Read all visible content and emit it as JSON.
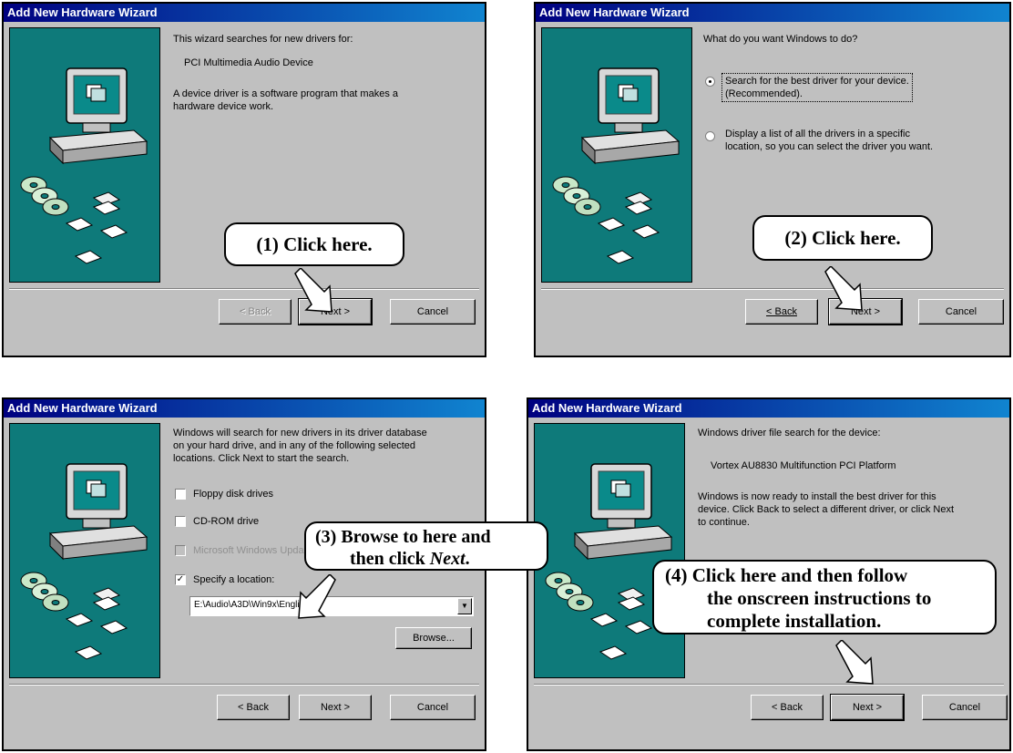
{
  "dialogs": [
    {
      "title": "Add New Hardware Wizard",
      "line1": "This wizard searches for new drivers for:",
      "device": "PCI Multimedia Audio Device",
      "desc1": "A device driver is a software program that makes a",
      "desc2": "hardware device work.",
      "buttons": {
        "back": "< Back",
        "next": "Next >",
        "cancel": "Cancel"
      },
      "callout": "(1)  Click here."
    },
    {
      "title": "Add New Hardware Wizard",
      "question": "What do you want Windows to do?",
      "option1_line1": "Search for the best driver for your device.",
      "option1_line2": "(Recommended).",
      "option2_line1": "Display a list of all the drivers in a specific",
      "option2_line2": "location, so you can select the driver you want.",
      "buttons": {
        "back": "< Back",
        "next": "Next >",
        "cancel": "Cancel"
      },
      "callout": "(2)  Click here."
    },
    {
      "title": "Add New Hardware Wizard",
      "intro1": "Windows will search for new drivers in its driver database",
      "intro2": "on your hard drive, and in any of the following selected",
      "intro3": "locations. Click Next to start the search.",
      "check_floppy": "Floppy disk drives",
      "check_cdrom": "CD-ROM drive",
      "check_msupdate": "Microsoft Windows Update",
      "check_specify": "Specify a location:",
      "location_value": "E:\\Audio\\A3D\\Win9x\\English",
      "browse": "Browse...",
      "buttons": {
        "back": "< Back",
        "next": "Next >",
        "cancel": "Cancel"
      },
      "callout_line1": "(3)  Browse to here and",
      "callout_line2": "then click ",
      "callout_italic": "Next",
      "callout_end": "."
    },
    {
      "title": "Add New Hardware Wizard",
      "line1": "Windows driver file search for the device:",
      "device": "Vortex AU8830 Multifunction PCI Platform",
      "ready1": "Windows is now ready to install the best driver for this",
      "ready2": "device. Click Back to select a different driver, or click Next",
      "ready3": "to continue.",
      "buttons": {
        "back": "< Back",
        "next": "Next >",
        "cancel": "Cancel"
      },
      "callout_line1": "(4)  Click here and then follow",
      "callout_line2": "the onscreen instructions to",
      "callout_line3": "complete installation."
    }
  ]
}
